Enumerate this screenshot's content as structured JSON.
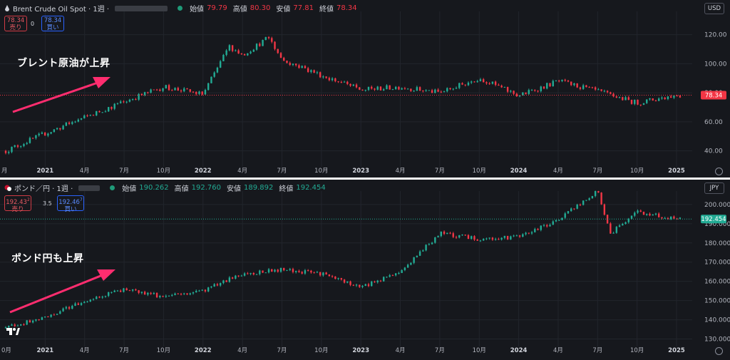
{
  "colors": {
    "up": "#22ab94",
    "down": "#f23645",
    "bg": "#16181d",
    "grid": "#22252c",
    "text": "#b2b5be",
    "arrow": "#ff2d6f"
  },
  "top": {
    "header": {
      "symbol": "Brent Crude Oil Spot · 1週 ·",
      "open_label": "始値",
      "open": "79.79",
      "high_label": "高値",
      "high": "80.30",
      "low_label": "安値",
      "low": "77.81",
      "close_label": "終値",
      "close": "78.34"
    },
    "sell": {
      "price": "78.34",
      "label": "売り"
    },
    "spread": "0",
    "buy": {
      "price": "78.34",
      "label": "買い"
    },
    "currency": "USD",
    "annotation": "ブレント原油が上昇",
    "price_label": "78.34",
    "yticks": [
      "120.00",
      "100.00",
      "80.00",
      "60.00",
      "40.00"
    ]
  },
  "bottom": {
    "header": {
      "symbol": "ポンド／円 · 1週 ·",
      "open_label": "始値",
      "open": "190.262",
      "high_label": "高値",
      "high": "192.760",
      "low_label": "安値",
      "low": "189.892",
      "close_label": "終値",
      "close": "192.454"
    },
    "sell": {
      "price": "192.43",
      "sup": "2",
      "label": "売り"
    },
    "spread": "3.5",
    "buy": {
      "price": "192.46",
      "sup": "7",
      "label": "買い"
    },
    "currency": "JPY",
    "annotation": "ポンド円も上昇",
    "price_label": "192.454",
    "yticks": [
      "200.000",
      "190.000",
      "180.000",
      "170.000",
      "160.000",
      "150.000",
      "140.000",
      "130.000"
    ]
  },
  "xticks": [
    "0月",
    "2021",
    "4月",
    "7月",
    "10月",
    "2022",
    "4月",
    "7月",
    "10月",
    "2023",
    "4月",
    "7月",
    "10月",
    "2024",
    "4月",
    "7月",
    "10月",
    "2025"
  ],
  "xticks_top_first": "月",
  "chart_data": [
    {
      "type": "candlestick",
      "title": "Brent Crude Oil Spot · 1週",
      "ylim": [
        30,
        135
      ],
      "x": [
        "2020-10",
        "2021-01",
        "2021-04",
        "2021-07",
        "2021-10",
        "2022-01",
        "2022-03",
        "2022-04",
        "2022-06",
        "2022-07",
        "2022-10",
        "2023-01",
        "2023-04",
        "2023-07",
        "2023-10",
        "2024-01",
        "2024-04",
        "2024-07",
        "2024-10",
        "2025-01"
      ],
      "close": [
        40,
        52,
        63,
        74,
        84,
        79,
        112,
        106,
        118,
        103,
        92,
        82,
        84,
        80,
        90,
        78,
        88,
        81,
        73,
        78.34
      ]
    },
    {
      "type": "candlestick",
      "title": "ポンド／円 · 1週",
      "ylim": [
        125,
        207
      ],
      "x": [
        "2020-10",
        "2021-01",
        "2021-04",
        "2021-07",
        "2021-10",
        "2022-01",
        "2022-04",
        "2022-07",
        "2022-10",
        "2023-01",
        "2023-04",
        "2023-07",
        "2023-10",
        "2024-01",
        "2024-04",
        "2024-07",
        "2024-08",
        "2024-10",
        "2025-01"
      ],
      "close": [
        136,
        141,
        150,
        156,
        152,
        155,
        164,
        166,
        164,
        157,
        165,
        185,
        182,
        183,
        192,
        207,
        185,
        196,
        192.454
      ]
    }
  ]
}
